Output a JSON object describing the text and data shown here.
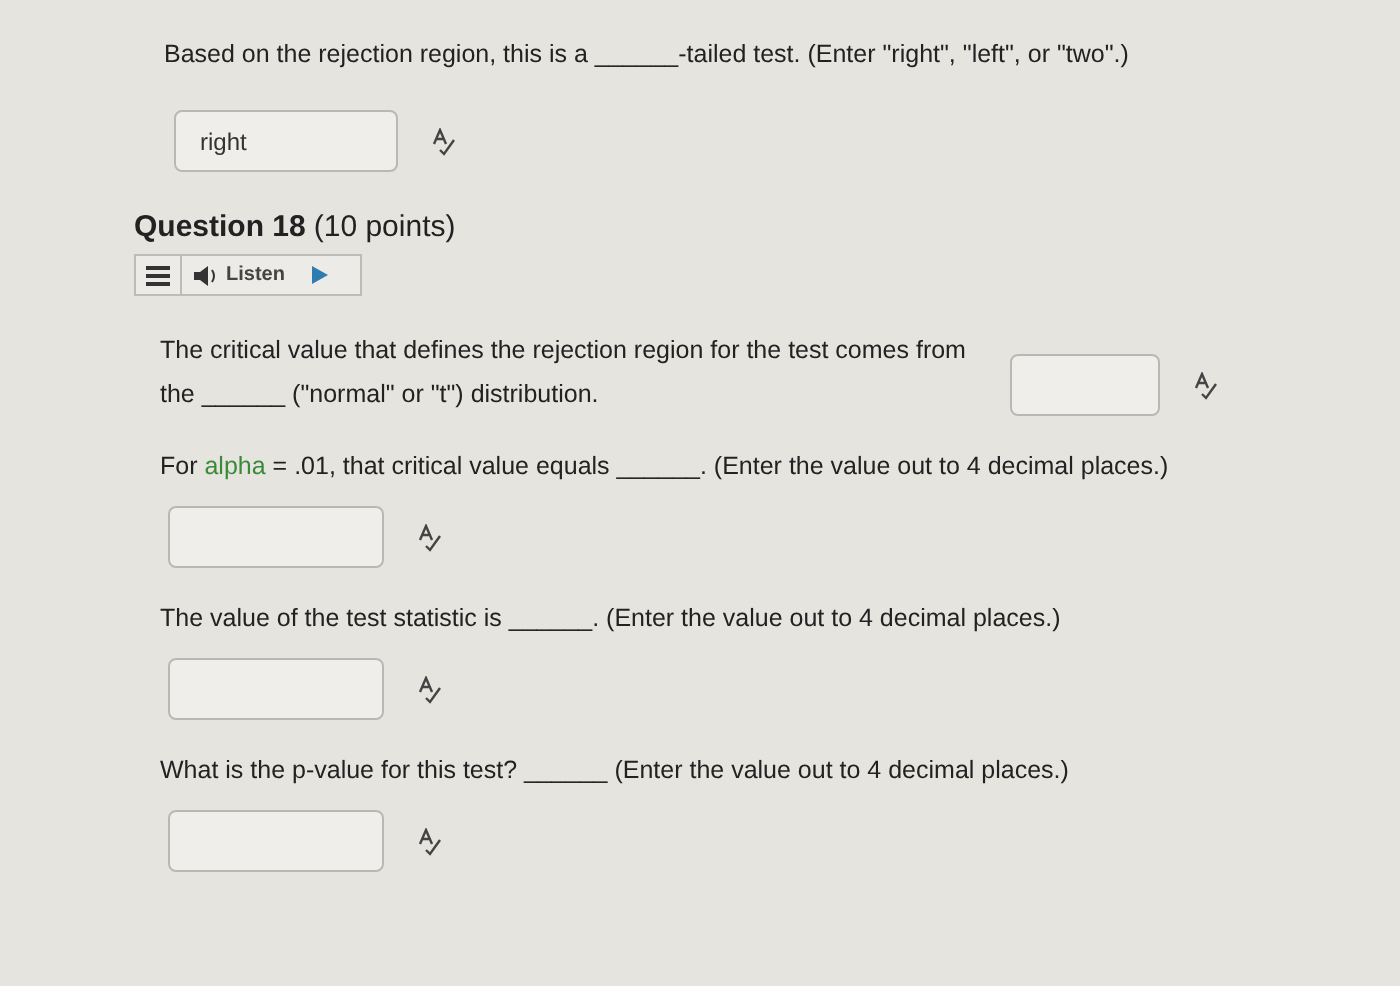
{
  "previous_question": {
    "text": "Based on the rejection region, this is a ______-tailed test. (Enter \"right\", \"left\", or \"two\".)",
    "answer": {
      "value": "right"
    }
  },
  "question": {
    "title": "Question 18",
    "points": "(10 points)",
    "listen": {
      "label": "Listen"
    },
    "parts": [
      {
        "kind": "inline",
        "segments": [
          {
            "text": "The critical value that defines the rejection region for the test comes from the ______ (\"normal\" or \"t\") distribution."
          }
        ]
      },
      {
        "kind": "below",
        "segments": [
          {
            "text": "For "
          },
          {
            "text": "alpha",
            "highlight": true
          },
          {
            "text": " = .01, that critical value equals ______.  (Enter the value out to 4 decimal places.)"
          }
        ]
      },
      {
        "kind": "below",
        "segments": [
          {
            "text": "The value of the test statistic is ______. (Enter the value out to 4 decimal places.)"
          }
        ]
      },
      {
        "kind": "below",
        "segments": [
          {
            "text": "What is the p-value for this test? ______ (Enter the value out to 4 decimal places.)"
          }
        ]
      }
    ]
  }
}
